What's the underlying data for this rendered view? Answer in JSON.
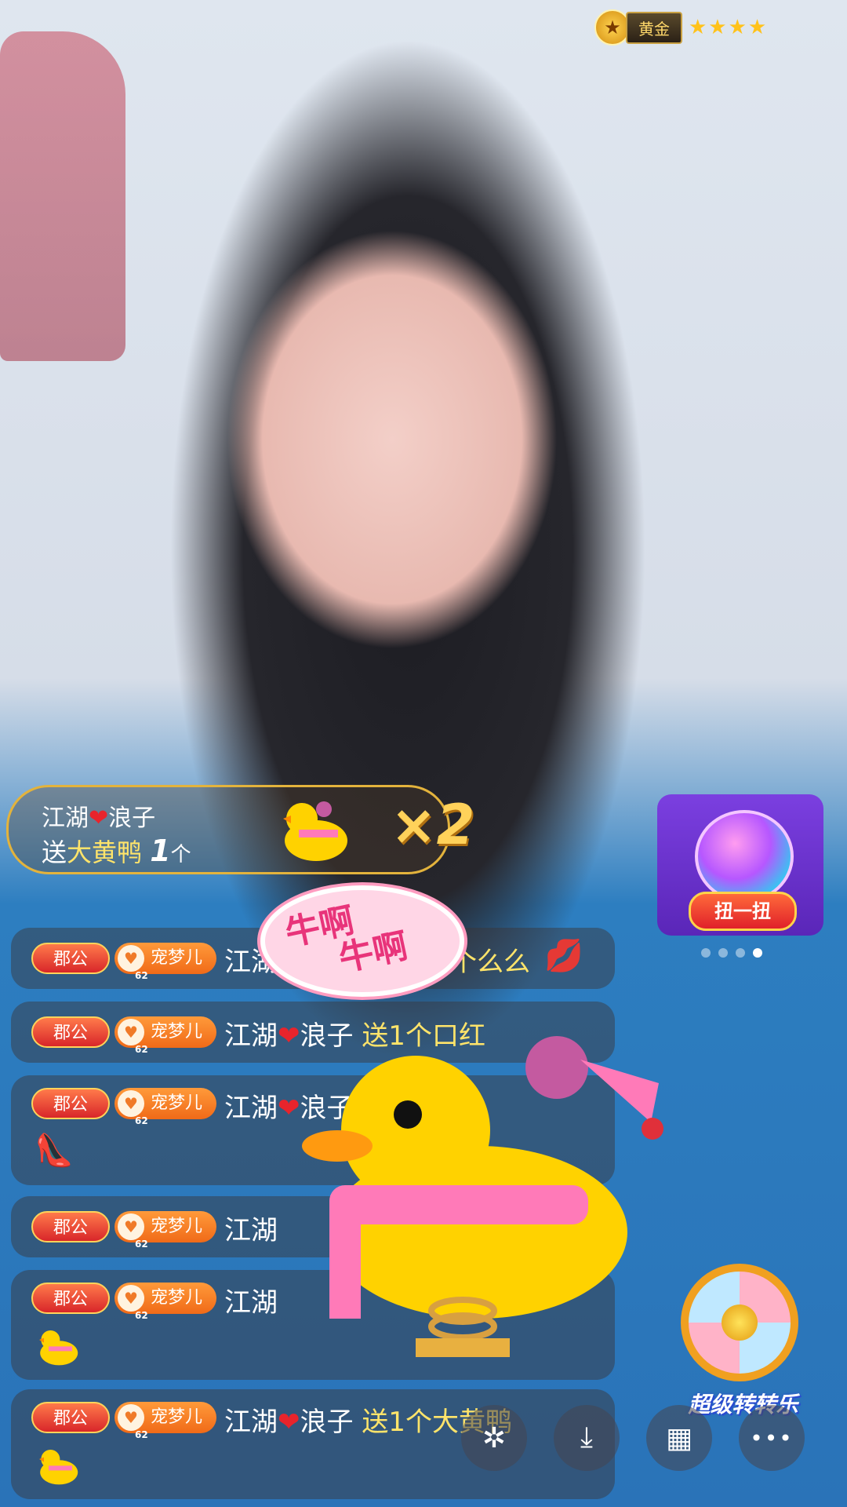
{
  "rank": {
    "medal_icon": "star-medal-icon",
    "label": "黄金",
    "stars": "★★★★"
  },
  "gift_banner": {
    "sender_name": "江湖",
    "sender_suffix": "浪子",
    "send_word": "送",
    "gift_name": "大黄鸭",
    "gift_count": "1",
    "unit": "个",
    "multiplier": "×2"
  },
  "side_widgets": {
    "twist_button": "扭一扭",
    "wheel_label": "超级转转乐",
    "carousel_dots": 4,
    "carousel_active": 4
  },
  "overlay_bubble": {
    "line1": "牛啊",
    "line2": "牛啊"
  },
  "chat": {
    "rows": [
      {
        "tag": "郡公",
        "pet": "宠梦儿",
        "pet_level": "62",
        "user": "江湖",
        "user_suffix": "",
        "msg": "个么么",
        "icon": "lips-icon"
      },
      {
        "tag": "郡公",
        "pet": "宠梦儿",
        "pet_level": "62",
        "user": "江湖",
        "user_suffix": "浪子",
        "msg": "送1个口红",
        "icon": ""
      },
      {
        "tag": "郡公",
        "pet": "宠梦儿",
        "pet_level": "62",
        "user": "江湖",
        "user_suffix": "浪子",
        "msg": "",
        "icon": "high-heel-icon"
      },
      {
        "tag": "郡公",
        "pet": "宠梦儿",
        "pet_level": "62",
        "user": "江湖",
        "user_suffix": "",
        "msg": "",
        "icon": ""
      },
      {
        "tag": "郡公",
        "pet": "宠梦儿",
        "pet_level": "62",
        "user": "江湖",
        "user_suffix": "",
        "msg": "",
        "icon": "duck-gift-icon"
      },
      {
        "tag": "郡公",
        "pet": "宠梦儿",
        "pet_level": "62",
        "user": "江湖",
        "user_suffix": "浪子",
        "msg": "送1个大黄鸭",
        "icon": "duck-gift-icon"
      }
    ]
  },
  "bottom_bar": {
    "buttons": [
      {
        "name": "sparkle-icon",
        "glyph": "✲"
      },
      {
        "name": "download-icon",
        "glyph": "⤓"
      },
      {
        "name": "grid-icon",
        "glyph": "▦"
      },
      {
        "name": "more-icon",
        "glyph": "•••"
      }
    ]
  },
  "colors": {
    "heart": "#e8242c",
    "gold": "#ffd25a",
    "purple": "#6a30d0"
  }
}
